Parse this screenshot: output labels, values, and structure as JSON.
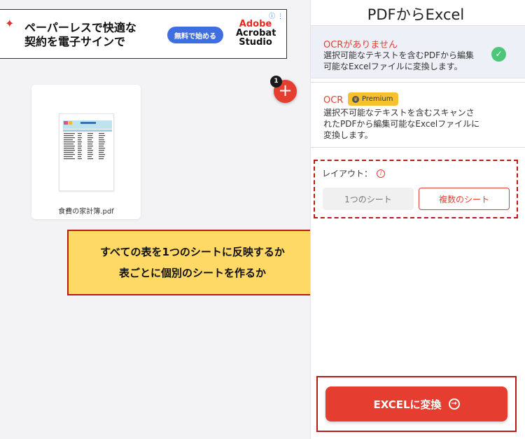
{
  "ad": {
    "line1": "ペーパーレスで快適な",
    "line2": "契約を電子サインで",
    "button_label": "無料で始める",
    "logo_line1": "Adobe",
    "logo_line2": "Acrobat",
    "logo_line3": "Studio",
    "info_glyph": "ⓘ ⋮"
  },
  "file": {
    "count": "1",
    "name": "食費の家計簿.pdf",
    "add_glyph": "+"
  },
  "callout": {
    "line1": "すべての表を1つのシートに反映するか",
    "line2": "表ごとに個別のシートを作るか"
  },
  "panel": {
    "title": "PDFからExcel",
    "options": [
      {
        "title": "OCRがありません",
        "desc_line1": "選択可能なテキストを含むPDFから編集",
        "desc_line2": "可能なExcelファイルに変換します。",
        "selected": true
      },
      {
        "title": "OCR",
        "badge": "Premium",
        "desc_line1": "選択不可能なテキストを含むスキャンさ",
        "desc_line2": "れたPDFから編集可能なExcelファイルに",
        "desc_line3": "変換します。",
        "selected": false
      }
    ],
    "layout": {
      "label": "レイアウト：",
      "info_glyph": "i",
      "option_single": "1つのシート",
      "option_multiple": "複数のシート",
      "selected": "複数のシート"
    },
    "convert_label": "EXCELに変換",
    "convert_glyph": "→"
  },
  "colors": {
    "accent": "#e53e30",
    "highlight": "#ffd966",
    "annotation_border": "#b81b14",
    "success": "#4cc77a",
    "premium": "#f6c02f"
  }
}
